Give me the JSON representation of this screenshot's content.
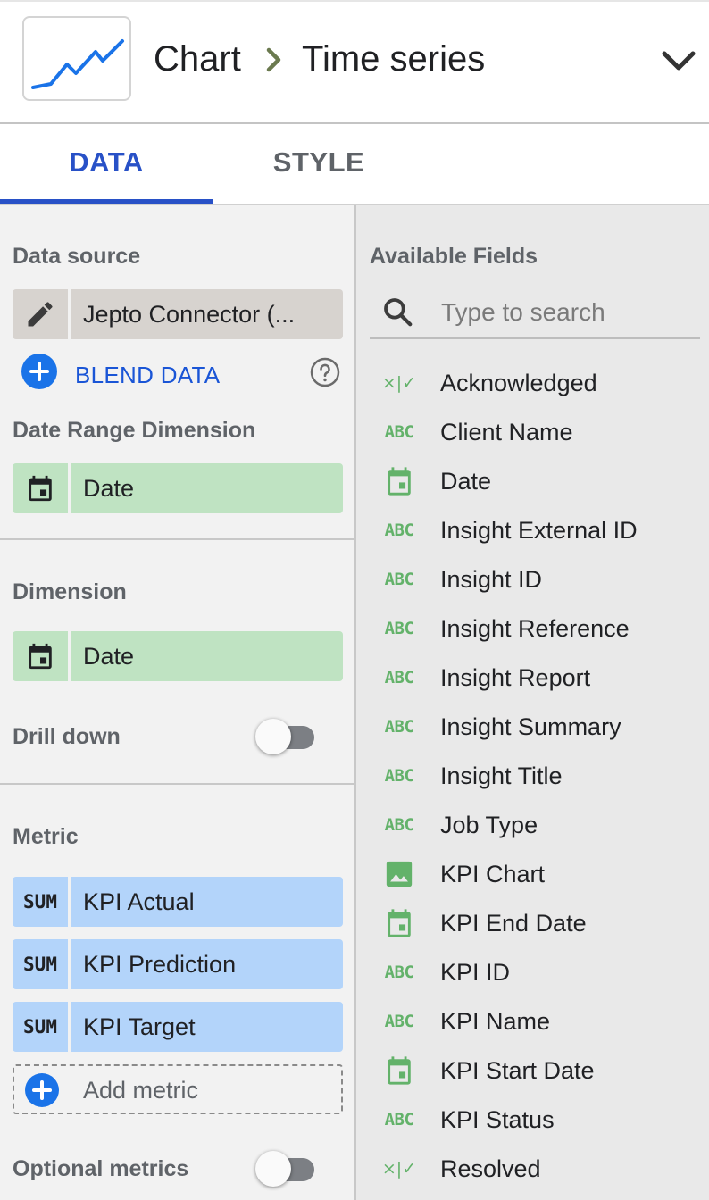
{
  "header": {
    "breadcrumb_root": "Chart",
    "breadcrumb_current": "Time series"
  },
  "tabs": [
    {
      "label": "DATA",
      "active": true
    },
    {
      "label": "STYLE",
      "active": false
    }
  ],
  "data_source": {
    "title": "Data source",
    "name": "Jepto Connector (...",
    "blend_label": "BLEND DATA"
  },
  "date_range_dimension": {
    "title": "Date Range Dimension",
    "field": "Date"
  },
  "dimension": {
    "title": "Dimension",
    "field": "Date",
    "drill_down_label": "Drill down",
    "drill_down_enabled": false
  },
  "metric": {
    "title": "Metric",
    "items": [
      {
        "aggregation": "SUM",
        "field": "KPI Actual"
      },
      {
        "aggregation": "SUM",
        "field": "KPI Prediction"
      },
      {
        "aggregation": "SUM",
        "field": "KPI Target"
      }
    ],
    "add_label": "Add metric"
  },
  "optional_metrics": {
    "label": "Optional metrics",
    "enabled": false
  },
  "available_fields": {
    "title": "Available Fields",
    "search_placeholder": "Type to search",
    "items": [
      {
        "type": "boolean",
        "type_text": "×|✓",
        "name": "Acknowledged"
      },
      {
        "type": "text",
        "type_text": "ABC",
        "name": "Client Name"
      },
      {
        "type": "date",
        "type_text": "",
        "name": "Date"
      },
      {
        "type": "text",
        "type_text": "ABC",
        "name": "Insight External ID"
      },
      {
        "type": "text",
        "type_text": "ABC",
        "name": "Insight ID"
      },
      {
        "type": "text",
        "type_text": "ABC",
        "name": "Insight Reference"
      },
      {
        "type": "text",
        "type_text": "ABC",
        "name": "Insight Report"
      },
      {
        "type": "text",
        "type_text": "ABC",
        "name": "Insight Summary"
      },
      {
        "type": "text",
        "type_text": "ABC",
        "name": "Insight Title"
      },
      {
        "type": "text",
        "type_text": "ABC",
        "name": "Job Type"
      },
      {
        "type": "image",
        "type_text": "",
        "name": "KPI Chart"
      },
      {
        "type": "date",
        "type_text": "",
        "name": "KPI End Date"
      },
      {
        "type": "text",
        "type_text": "ABC",
        "name": "KPI ID"
      },
      {
        "type": "text",
        "type_text": "ABC",
        "name": "KPI Name"
      },
      {
        "type": "date",
        "type_text": "",
        "name": "KPI Start Date"
      },
      {
        "type": "text",
        "type_text": "ABC",
        "name": "KPI Status"
      },
      {
        "type": "boolean",
        "type_text": "×|✓",
        "name": "Resolved"
      }
    ]
  },
  "colors": {
    "accent_blue": "#2851c7",
    "dimension_chip": "#bfe3c2",
    "metric_chip": "#b3d4fa",
    "field_icon_green": "#63b26a"
  }
}
